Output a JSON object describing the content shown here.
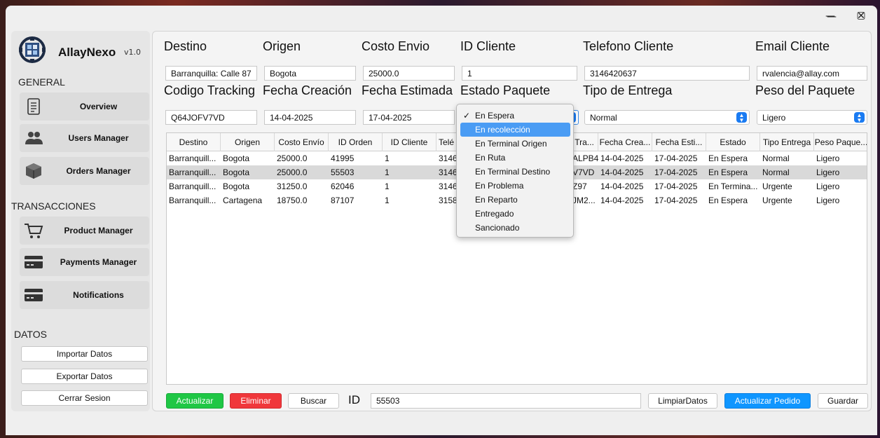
{
  "window": {
    "minimize": "—",
    "maximize": "▢",
    "close": "✕"
  },
  "sidebar": {
    "app_name": "AllayNexo",
    "app_version": "v1.0",
    "section_general": "GENERAL",
    "section_transacciones": "TRANSACCIONES",
    "section_datos": "DATOS",
    "items": [
      {
        "label": "Overview",
        "icon": "document-icon"
      },
      {
        "label": "Users Manager",
        "icon": "users-icon"
      },
      {
        "label": "Orders Manager",
        "icon": "box-icon"
      },
      {
        "label": "Product Manager",
        "icon": "cart-icon"
      },
      {
        "label": "Payments Manager",
        "icon": "card-icon"
      },
      {
        "label": "Notifications",
        "icon": "card-icon"
      }
    ],
    "datos_buttons": [
      "Importar Datos",
      "Exportar Datos",
      "Cerrar Sesion"
    ]
  },
  "form": {
    "labels": {
      "destino": "Destino",
      "origen": "Origen",
      "costo": "Costo Envio",
      "id_cliente": "ID Cliente",
      "telefono": "Telefono Cliente",
      "email": "Email Cliente",
      "tracking": "Codigo Tracking",
      "fecha_creacion": "Fecha Creación",
      "fecha_estimada": "Fecha Estimada",
      "estado": "Estado Paquete",
      "tipo_entrega": "Tipo de Entrega",
      "peso": "Peso del Paquete"
    },
    "values": {
      "destino": "Barranquilla: Calle 87",
      "origen": "Bogota",
      "costo": "25000.0",
      "id_cliente": "1",
      "telefono": "3146420637",
      "email": "rvalencia@allay.com",
      "tracking": "Q64JOFV7VD",
      "fecha_creacion": "14-04-2025",
      "fecha_estimada": "17-04-2025",
      "tipo_entrega": "Normal",
      "peso": "Ligero"
    }
  },
  "table": {
    "headers": [
      "Destino",
      "Origen",
      "Costo Envío",
      "ID Orden",
      "ID Cliente",
      "Telé",
      "Tra...",
      "Fecha Crea...",
      "Fecha Esti...",
      "Estado",
      "Tipo Entrega",
      "Peso Paque..."
    ],
    "rows": [
      {
        "destino": "Barranquill...",
        "origen": "Bogota",
        "costo": "25000.0",
        "id_orden": "41995",
        "id_cliente": "1",
        "tel": "3146",
        "track": "ALPB4",
        "fcrea": "14-04-2025",
        "festi": "17-04-2025",
        "estado": "En Espera",
        "tipo": "Normal",
        "peso": "Ligero",
        "selected": false
      },
      {
        "destino": "Barranquill...",
        "origen": "Bogota",
        "costo": "25000.0",
        "id_orden": "55503",
        "id_cliente": "1",
        "tel": "3146",
        "track": "V7VD",
        "fcrea": "14-04-2025",
        "festi": "17-04-2025",
        "estado": "En Espera",
        "tipo": "Normal",
        "peso": "Ligero",
        "selected": true
      },
      {
        "destino": "Barranquill...",
        "origen": "Bogota",
        "costo": "31250.0",
        "id_orden": "62046",
        "id_cliente": "1",
        "tel": "3146",
        "track": "Z97",
        "fcrea": "14-04-2025",
        "festi": "17-04-2025",
        "estado": "En Termina...",
        "tipo": "Urgente",
        "peso": "Ligero",
        "selected": false
      },
      {
        "destino": "Barranquill...",
        "origen": "Cartagena",
        "costo": "18750.0",
        "id_orden": "87107",
        "id_cliente": "1",
        "tel": "3158",
        "track": "JM2...",
        "fcrea": "14-04-2025",
        "festi": "17-04-2025",
        "estado": "En Espera",
        "tipo": "Urgente",
        "peso": "Ligero",
        "selected": false
      }
    ]
  },
  "estado_dropdown": {
    "selected": "En Espera",
    "highlighted": "En recolección",
    "options": [
      "En Espera",
      "En recolección",
      "En Terminal Origen",
      "En Ruta",
      "En Terminal Destino",
      "En Problema",
      "En Reparto",
      "Entregado",
      "Sancionado"
    ]
  },
  "bottom": {
    "actualizar": "Actualizar",
    "eliminar": "Eliminar",
    "buscar": "Buscar",
    "id_label": "ID",
    "id_value": "55503",
    "limpiar": "LimpiarDatos",
    "actualizar_pedido": "Actualizar Pedido",
    "guardar": "Guardar"
  },
  "colors": {
    "green": "#1fc745",
    "red": "#f0373b",
    "blue": "#0f96ff",
    "highlight": "#4a9cf4",
    "combo_arrow": "#1a7bf2"
  }
}
